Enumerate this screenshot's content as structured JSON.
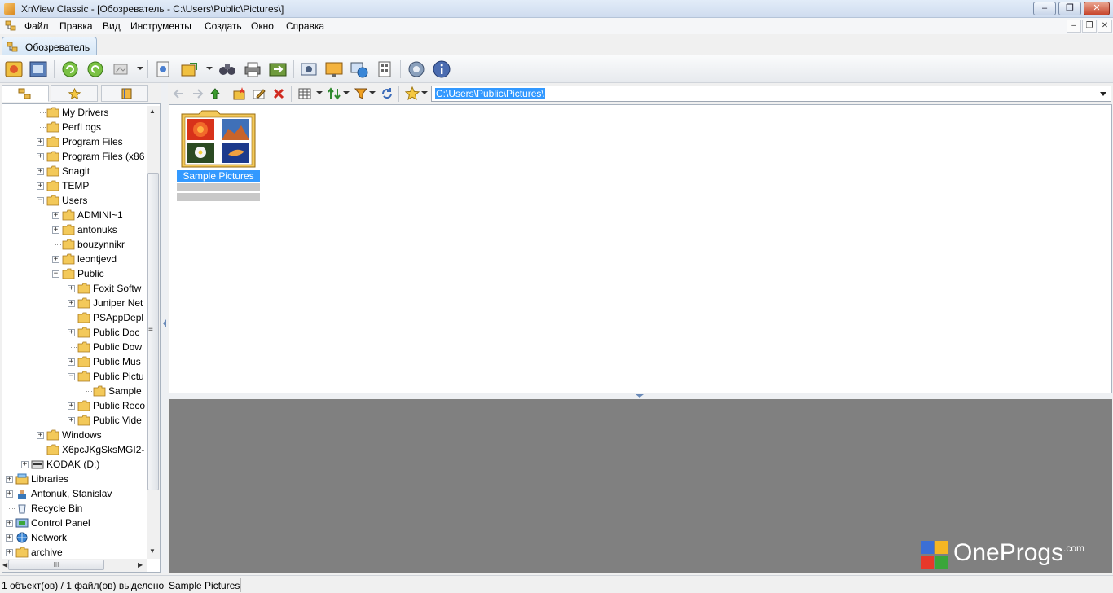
{
  "window": {
    "title": "XnView Classic - [Обозреватель - C:\\Users\\Public\\Pictures\\]",
    "min": "‒",
    "max": "❐",
    "close": "✕"
  },
  "menu": {
    "items": [
      "Файл",
      "Правка",
      "Вид",
      "Инструменты",
      "Создать",
      "Окно",
      "Справка"
    ],
    "mdi_min": "–",
    "mdi_restore": "❐",
    "mdi_close": "✕"
  },
  "tabs": [
    {
      "label": "Обозреватель"
    }
  ],
  "address": {
    "value": "C:\\Users\\Public\\Pictures\\"
  },
  "tree": {
    "nodes": [
      {
        "label": "My Drivers"
      },
      {
        "label": "PerfLogs"
      },
      {
        "label": "Program Files",
        "exp": "+"
      },
      {
        "label": "Program Files (x86",
        "exp": "+"
      },
      {
        "label": "Snagit",
        "exp": "+"
      },
      {
        "label": "TEMP",
        "exp": "+"
      },
      {
        "label": "Users",
        "exp": "−"
      },
      {
        "label": "ADMINI~1",
        "exp": "+"
      },
      {
        "label": "antonuks",
        "exp": "+"
      },
      {
        "label": "bouzynnikr"
      },
      {
        "label": "leontjevd",
        "exp": "+"
      },
      {
        "label": "Public",
        "exp": "−"
      },
      {
        "label": "Foxit Softw",
        "exp": "+"
      },
      {
        "label": "Juniper Net",
        "exp": "+"
      },
      {
        "label": "PSAppDepl"
      },
      {
        "label": "Public Doc",
        "exp": "+"
      },
      {
        "label": "Public Dow"
      },
      {
        "label": "Public Mus",
        "exp": "+"
      },
      {
        "label": "Public Pictu",
        "exp": "−"
      },
      {
        "label": "Sample"
      },
      {
        "label": "Public Reco",
        "exp": "+"
      },
      {
        "label": "Public Vide",
        "exp": "+"
      },
      {
        "label": "Windows",
        "exp": "+"
      },
      {
        "label": "X6pcJKgSksMGI2-"
      },
      {
        "label": "KODAK (D:)",
        "exp": "+"
      },
      {
        "label": "Libraries",
        "exp": "+"
      },
      {
        "label": "Antonuk, Stanislav",
        "exp": "+"
      },
      {
        "label": "Recycle Bin"
      },
      {
        "label": "Control Panel",
        "exp": "+"
      },
      {
        "label": "Network",
        "exp": "+"
      },
      {
        "label": "archive",
        "exp": "+"
      }
    ],
    "scroll_up": "▲",
    "scroll_down": "▼",
    "scroll_left": "◀",
    "scroll_right": "▶",
    "hgrip": "III",
    "vgrip": "≡"
  },
  "browser": {
    "items": [
      {
        "label": "Sample Pictures"
      }
    ]
  },
  "status": {
    "left": "1 объект(ов) / 1 файл(ов) выделено",
    "right": "Sample Pictures"
  },
  "watermark": {
    "text": "OneProgs",
    "suffix": ".com"
  },
  "colors": {
    "selection": "#3399ff",
    "preview_bg": "#808080",
    "folder": "#f3c95a"
  }
}
